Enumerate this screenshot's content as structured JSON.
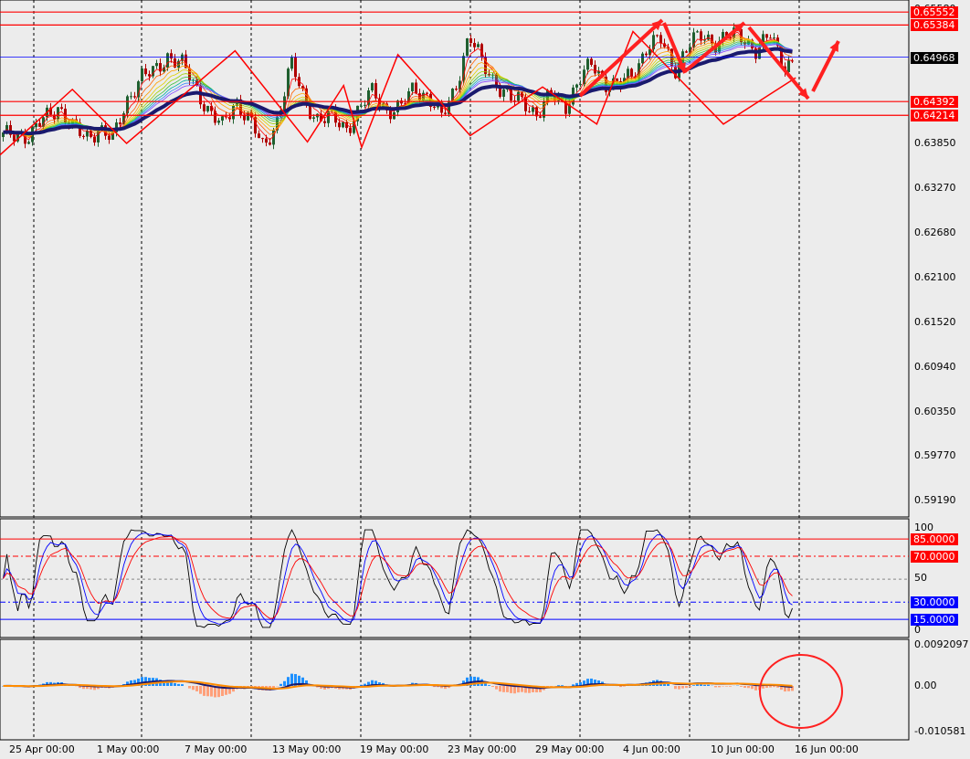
{
  "chart_data": {
    "type": "candlestick",
    "title": "",
    "main": {
      "price_ticks": [
        "0.65580",
        "0.63850",
        "0.63270",
        "0.62680",
        "0.62100",
        "0.61520",
        "0.60940",
        "0.60350",
        "0.59770",
        "0.59190"
      ],
      "close_path": [
        0.63933,
        0.63992,
        0.63933,
        0.6417,
        0.64347,
        0.64051,
        0.63933,
        0.64051,
        0.63874,
        0.64406,
        0.64702,
        0.64761,
        0.64998,
        0.6488,
        0.64584,
        0.64288,
        0.64051,
        0.64406,
        0.6417,
        0.63755,
        0.6417,
        0.6488,
        0.64406,
        0.6417,
        0.6417,
        0.64051,
        0.64288,
        0.64525,
        0.64288,
        0.64288,
        0.64584,
        0.64465,
        0.6417,
        0.64584,
        0.65235,
        0.6488,
        0.64643,
        0.64406,
        0.64406,
        0.64229,
        0.64465,
        0.64347,
        0.64643,
        0.6488,
        0.64643,
        0.64584,
        0.64761,
        0.65116,
        0.65175,
        0.6482,
        0.65116,
        0.65235,
        0.65175,
        0.65235,
        0.65235,
        0.65057,
        0.65235,
        0.6488,
        0.64939
      ],
      "zigzag": [
        [
          0,
          0.637
        ],
        [
          4,
          0.6455
        ],
        [
          7,
          0.6385
        ],
        [
          13,
          0.6505
        ],
        [
          17,
          0.6387
        ],
        [
          19,
          0.646
        ],
        [
          20,
          0.638
        ],
        [
          22,
          0.65
        ],
        [
          26,
          0.6395
        ],
        [
          30,
          0.6458
        ],
        [
          33,
          0.641
        ],
        [
          35,
          0.653
        ],
        [
          40,
          0.641
        ],
        [
          44,
          0.647
        ]
      ],
      "levels": [
        {
          "label": "0.65552",
          "value": 0.65552,
          "color": "#ff0000"
        },
        {
          "label": "0.65384",
          "value": 0.65384,
          "color": "#ff0000"
        },
        {
          "label": "0.64968",
          "value": 0.64968,
          "color": "#0000ff",
          "current": true
        },
        {
          "label": "0.64392",
          "value": 0.64392,
          "color": "#ff0000"
        },
        {
          "label": "0.64214",
          "value": 0.64214,
          "color": "#ff0000"
        }
      ]
    },
    "stochastic": {
      "levels": [
        {
          "label": "85.0000",
          "value": 85,
          "color": "#ff0000"
        },
        {
          "label": "70.0000",
          "value": 70,
          "color": "#ff0000"
        },
        {
          "label": "30.0000",
          "value": 30,
          "color": "#0000ff"
        },
        {
          "label": "15.0000",
          "value": 15,
          "color": "#0000ff"
        }
      ],
      "ticks": [
        "100",
        "50",
        "0"
      ],
      "ylim": [
        0,
        100
      ]
    },
    "macd": {
      "ticks": [
        "0.0092097",
        "0.00",
        "-0.010581"
      ],
      "ylim": [
        -0.010581,
        0.0092097
      ]
    },
    "x_labels": [
      "25 Apr 00:00",
      "1 May 00:00",
      "7 May 00:00",
      "13 May 00:00",
      "19 May 00:00",
      "23 May 00:00",
      "29 May 00:00",
      "4 Jun 00:00",
      "10 Jun 00:00",
      "16 Jun 00:00"
    ]
  }
}
